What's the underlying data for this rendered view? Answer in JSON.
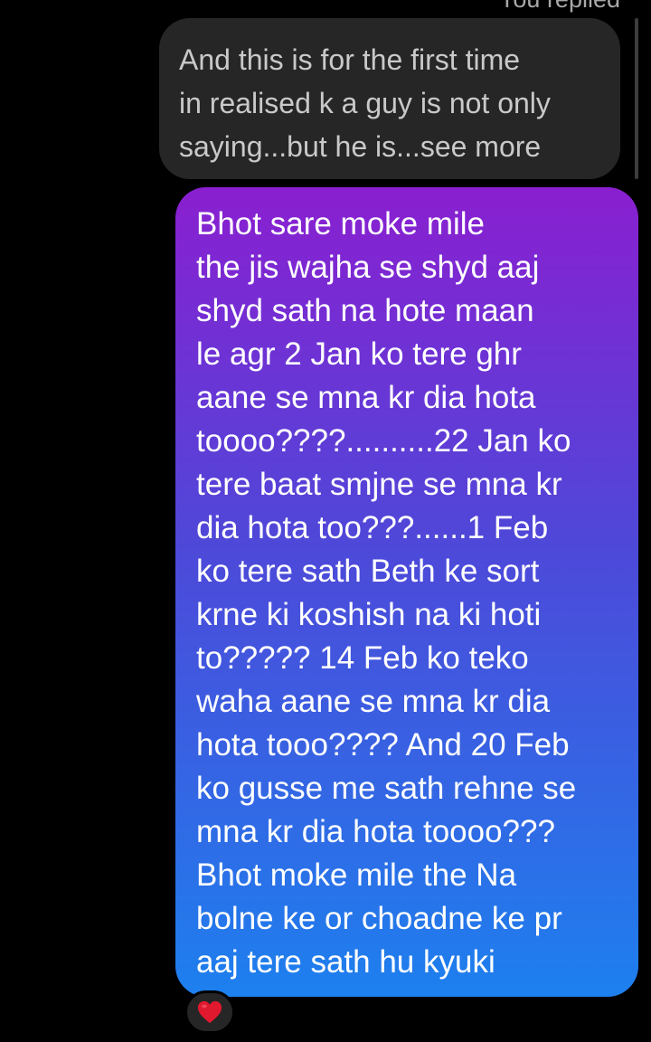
{
  "header": {
    "replied_label": "You replied"
  },
  "quoted_message": {
    "lines": [
      "And this is for the first time",
      "in realised k a guy is not only",
      "saying...but he is...see more"
    ]
  },
  "message": {
    "lines": [
      "Bhot sare moke mile",
      "the jis wajha se shyd aaj",
      "shyd sath na hote maan",
      "le agr 2 Jan ko tere ghr",
      "aane se mna kr dia hota",
      "toooo????..........22 Jan ko",
      "tere baat smjne se mna kr",
      "dia hota too???......1 Feb",
      "ko tere sath Beth ke sort",
      "krne ki koshish na ki hoti",
      "to????? 14 Feb ko teko",
      "waha aane se mna kr dia",
      "hota tooo???? And 20 Feb",
      "ko gusse me sath rehne se",
      "mna kr dia hota toooo???",
      "Bhot moke mile the Na",
      "bolne ke or choadne ke pr",
      "aaj tere sath hu kyuki"
    ]
  },
  "reaction": {
    "icon": "heart-icon",
    "color": "#e0192f"
  },
  "colors": {
    "background": "#000000",
    "quoted_bubble": "#262626",
    "gradient_top": "#8a1fd0",
    "gradient_middle": "#4d49d9",
    "gradient_bottom": "#1d80ee"
  }
}
